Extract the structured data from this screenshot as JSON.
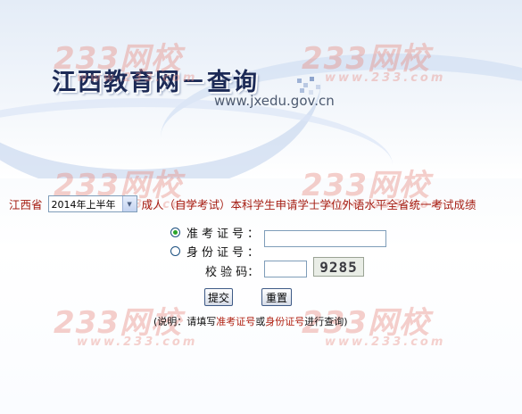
{
  "header": {
    "title": "江西教育网－查询",
    "domain": "www.jxedu.gov.cn"
  },
  "watermark": {
    "text": "233网校",
    "url": "www.233.com"
  },
  "exam": {
    "province": "江西省",
    "term_selected": "2014年上半年",
    "description": "成人（自学考试）本科学生申请学士学位外语水平全省统一考试成绩"
  },
  "form": {
    "radio_admission_label": "准考证号：",
    "radio_admission_selected": true,
    "radio_id_label": "身份证号：",
    "captcha_label": "校 验 码：",
    "captcha_code": "9285",
    "admission_value": "",
    "captcha_value": ""
  },
  "buttons": {
    "submit": "提交",
    "reset": "重置"
  },
  "note": {
    "prefix": "(说明：请填写",
    "admission": "准考证号",
    "or": "或",
    "id": "身份证号",
    "suffix": "进行查询)"
  },
  "colors": {
    "accent_red": "#a51d12",
    "title_navy": "#1c2a56",
    "watermark": "#e88c82"
  }
}
